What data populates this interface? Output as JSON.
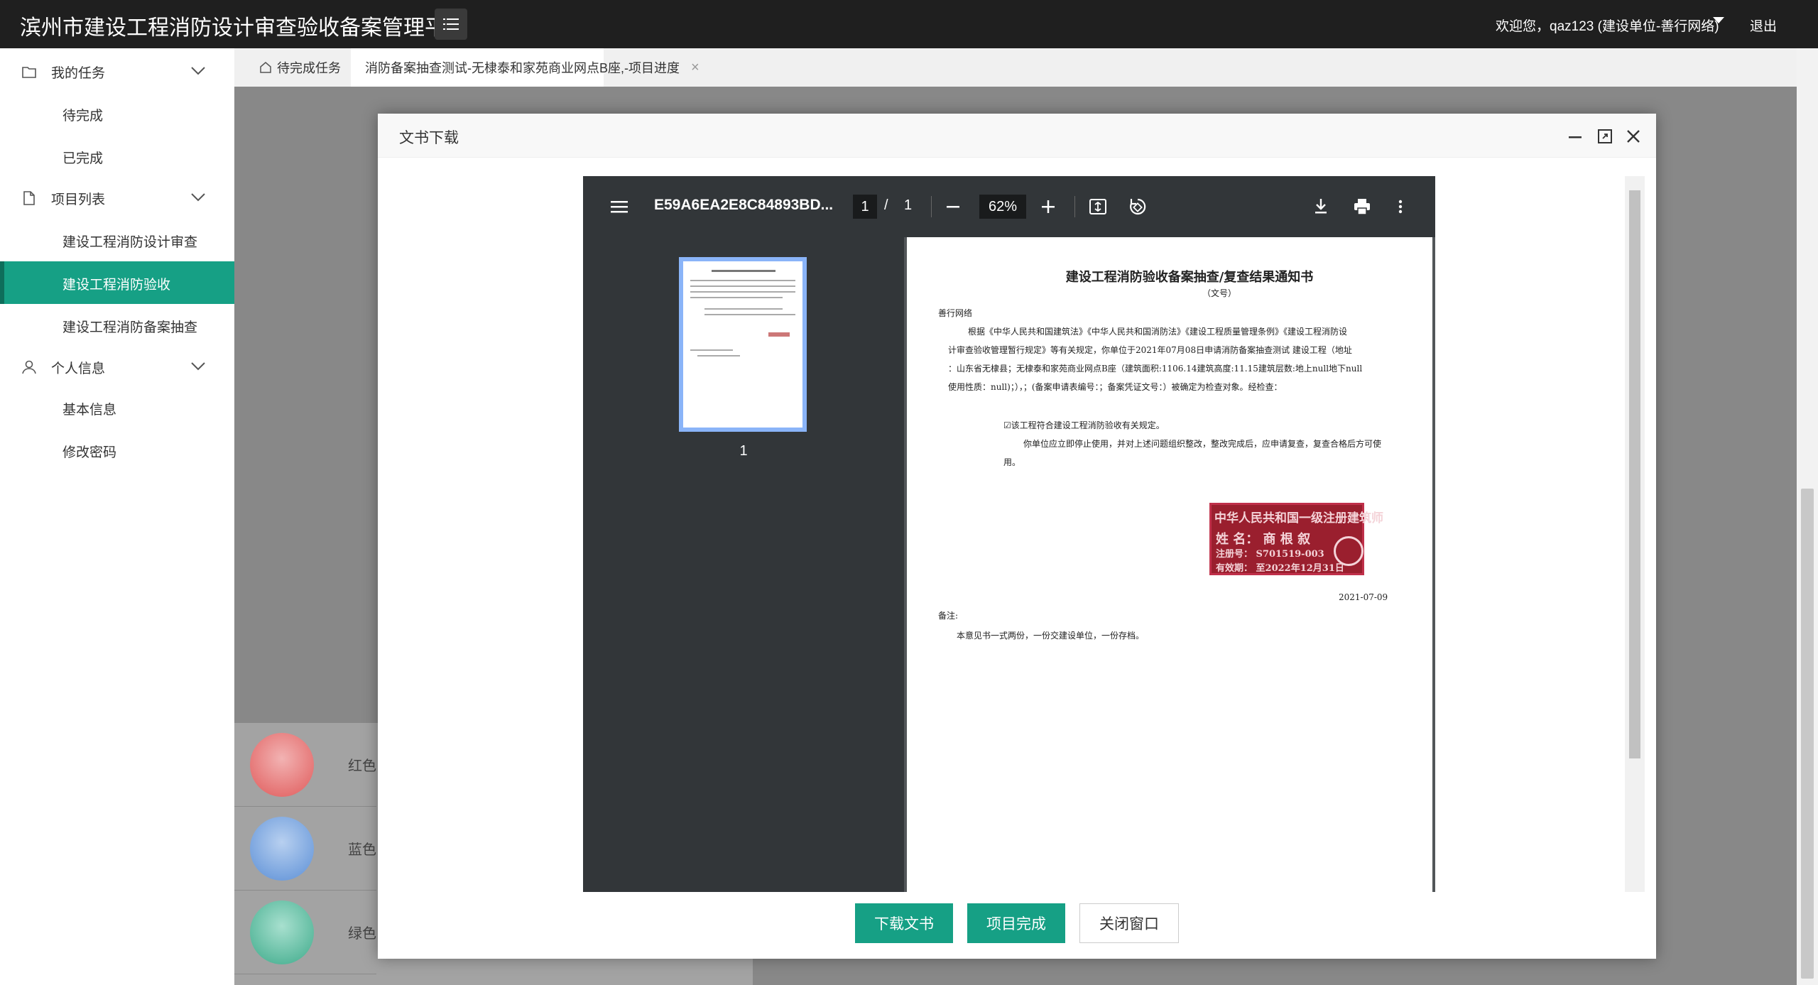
{
  "header": {
    "title": "滨州市建设工程消防设计审查验收备案管理平台",
    "welcome": "欢迎您，qaz123 (建设单位-善行网络)",
    "logout": "退出"
  },
  "sidebar": {
    "groups": [
      {
        "label": "我的任务",
        "icon": "folder-icon"
      },
      {
        "label": "项目列表",
        "icon": "file-icon"
      },
      {
        "label": "个人信息",
        "icon": "user-icon"
      }
    ],
    "items": {
      "pending": "待完成",
      "done": "已完成",
      "design_review": "建设工程消防设计审查",
      "acceptance": "建设工程消防验收",
      "filing_check": "建设工程消防备案抽查",
      "basic_info": "基本信息",
      "change_password": "修改密码"
    }
  },
  "tabs": {
    "home": "待完成任务",
    "current": "消防备案抽查测试-无棣泰和家苑商业网点B座,-项目进度"
  },
  "background_rows": [
    {
      "label": "红色",
      "color": "#e05a5a"
    },
    {
      "label": "蓝色",
      "color": "#5b8fd6"
    },
    {
      "label": "绿色",
      "color": "#3daa8a"
    }
  ],
  "modal": {
    "title": "文书下载",
    "buttons": {
      "download": "下载文书",
      "complete": "项目完成",
      "close": "关闭窗口"
    }
  },
  "pdf_viewer": {
    "file_name": "E59A6EA2E8C84893BD...",
    "page": "1",
    "page_sep": "/",
    "total_pages": "1",
    "zoom": "62%",
    "thumb_page": "1"
  },
  "document": {
    "title": "建设工程消防验收备案抽查/复查结果通知书",
    "doc_no": "（文号）",
    "recipient": "善行网络",
    "body_line1": "根据《中华人民共和国建筑法》《中华人民共和国消防法》《建设工程质量管理条例》《建设工程消防设",
    "body_line2": "计审查验收管理暂行规定》等有关规定，你单位于2021年07月08日申请消防备案抽查测试 建设工程（地址",
    "body_line3": "：山东省无棣县；无棣泰和家苑商业网点B座（建筑面积:1106.14建筑高度:11.15建筑层数:地上null地下null",
    "body_line4": "使用性质：null)；），；(备案申请表编号：；备案凭证文号：）被确定为检查对象。经检查：",
    "check_item": "☑该工程符合建设工程消防验收有关规定。",
    "notice_line1": "你单位应立即停止使用，并对上述问题组织整改，整改完成后，应申请复查，复查合格后方可使",
    "notice_line2": "用。",
    "stamp": {
      "line1": "中华人民共和国一级注册建筑师",
      "line2": "姓 名： 商 根 叙",
      "line3": "注册号： S701519-003",
      "line4": "有效期： 至2022年12月31日"
    },
    "date": "2021-07-09",
    "remark_label": "备注:",
    "remark_text": "本意见书一式两份，一份交建设单位，一份存档。"
  }
}
